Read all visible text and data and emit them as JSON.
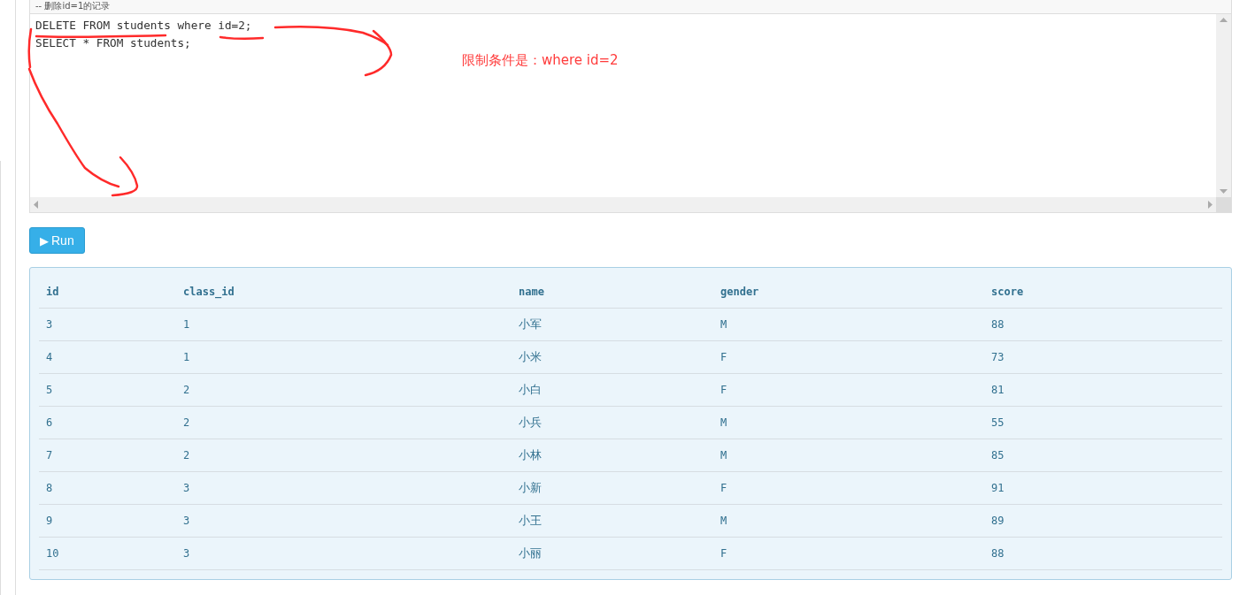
{
  "editor": {
    "comment": "-- 删除id=1的记录",
    "lines": [
      "DELETE FROM students where id=2;",
      "SELECT * FROM students;"
    ]
  },
  "annotation": {
    "text": "限制条件是：where id=2"
  },
  "run_button": {
    "icon": "▶",
    "label": "Run"
  },
  "table": {
    "columns": [
      "id",
      "class_id",
      "name",
      "gender",
      "score"
    ],
    "rows": [
      [
        "3",
        "1",
        "小军",
        "M",
        "88"
      ],
      [
        "4",
        "1",
        "小米",
        "F",
        "73"
      ],
      [
        "5",
        "2",
        "小白",
        "F",
        "81"
      ],
      [
        "6",
        "2",
        "小兵",
        "M",
        "55"
      ],
      [
        "7",
        "2",
        "小林",
        "M",
        "85"
      ],
      [
        "8",
        "3",
        "小新",
        "F",
        "91"
      ],
      [
        "9",
        "3",
        "小王",
        "M",
        "89"
      ],
      [
        "10",
        "3",
        "小丽",
        "F",
        "88"
      ]
    ]
  }
}
